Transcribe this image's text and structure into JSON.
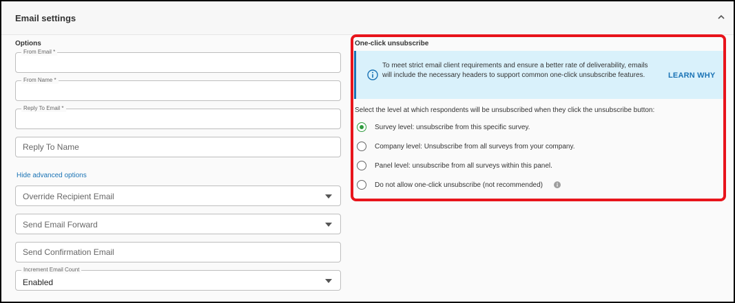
{
  "header": {
    "title": "Email settings"
  },
  "options": {
    "label": "Options",
    "from_email": {
      "label": "From Email *",
      "value": ""
    },
    "from_name": {
      "label": "From Name *",
      "value": ""
    },
    "reply_to_email": {
      "label": "Reply To Email *",
      "value": ""
    },
    "reply_to_name": {
      "placeholder": "Reply To Name"
    },
    "advanced_link": "Hide advanced options",
    "override_recipient": {
      "placeholder": "Override Recipient Email"
    },
    "send_forward": {
      "placeholder": "Send Email Forward"
    },
    "send_confirmation": {
      "placeholder": "Send Confirmation Email"
    },
    "increment_count": {
      "label": "Increment Email Count",
      "value": "Enabled"
    }
  },
  "unsubscribe": {
    "title": "One-click unsubscribe",
    "info_text": "To meet strict email client requirements and ensure a better rate of deliverability, emails will include the necessary headers to support common one-click unsubscribe features.",
    "learn_why": "LEARN WHY",
    "description": "Select the level at which respondents will be unsubscribed when they click the unsubscribe button:",
    "levels": [
      {
        "label": "Survey level: unsubscribe from this specific survey.",
        "selected": true
      },
      {
        "label": "Company level:   Unsubscribe from all surveys from your company.",
        "selected": false
      },
      {
        "label": "Panel level: unsubscribe from all surveys within this panel.",
        "selected": false
      },
      {
        "label": "Do not allow one-click unsubscribe (not recommended)",
        "selected": false
      }
    ]
  },
  "colors": {
    "accent": "#1a73b5",
    "selected_radio": "#2e9b3e",
    "info_background": "#d9f1fb",
    "highlight": "#e8141b"
  }
}
